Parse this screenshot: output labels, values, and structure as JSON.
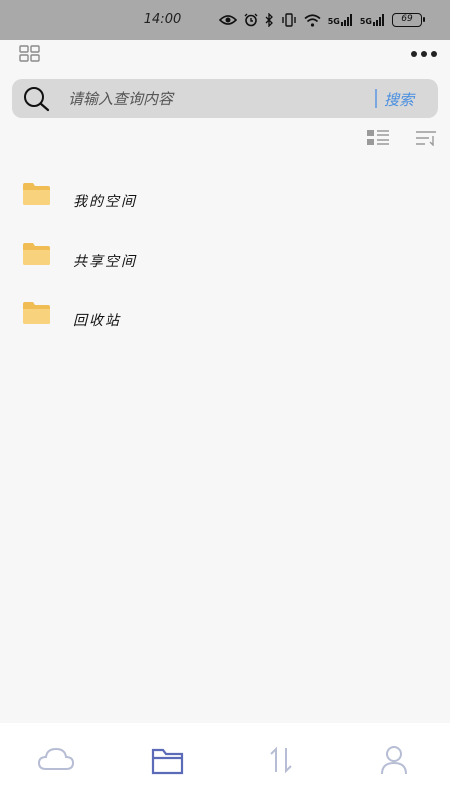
{
  "status_bar": {
    "time": "14:00",
    "network_1": "5G",
    "network_2": "5G",
    "battery": "69"
  },
  "search": {
    "placeholder": "请输入查询内容",
    "button_label": "搜索"
  },
  "folders": [
    {
      "label": "我的空间",
      "icon": "folder-icon"
    },
    {
      "label": "共享空间",
      "icon": "folder-icon"
    },
    {
      "label": "回收站",
      "icon": "folder-icon"
    }
  ],
  "bottom_nav": [
    {
      "icon": "cloud-icon",
      "active": false
    },
    {
      "icon": "files-icon",
      "active": true
    },
    {
      "icon": "transfer-icon",
      "active": false
    },
    {
      "icon": "user-icon",
      "active": false
    }
  ],
  "colors": {
    "status_bar_bg": "#a9a9a9",
    "page_bg": "#f7f7f7",
    "search_bg": "#d8d8d8",
    "accent_blue": "#4a8fe0",
    "folder_yellow": "#f5c96a",
    "nav_active": "#5b6bb8",
    "nav_inactive": "#b7bdd4"
  }
}
